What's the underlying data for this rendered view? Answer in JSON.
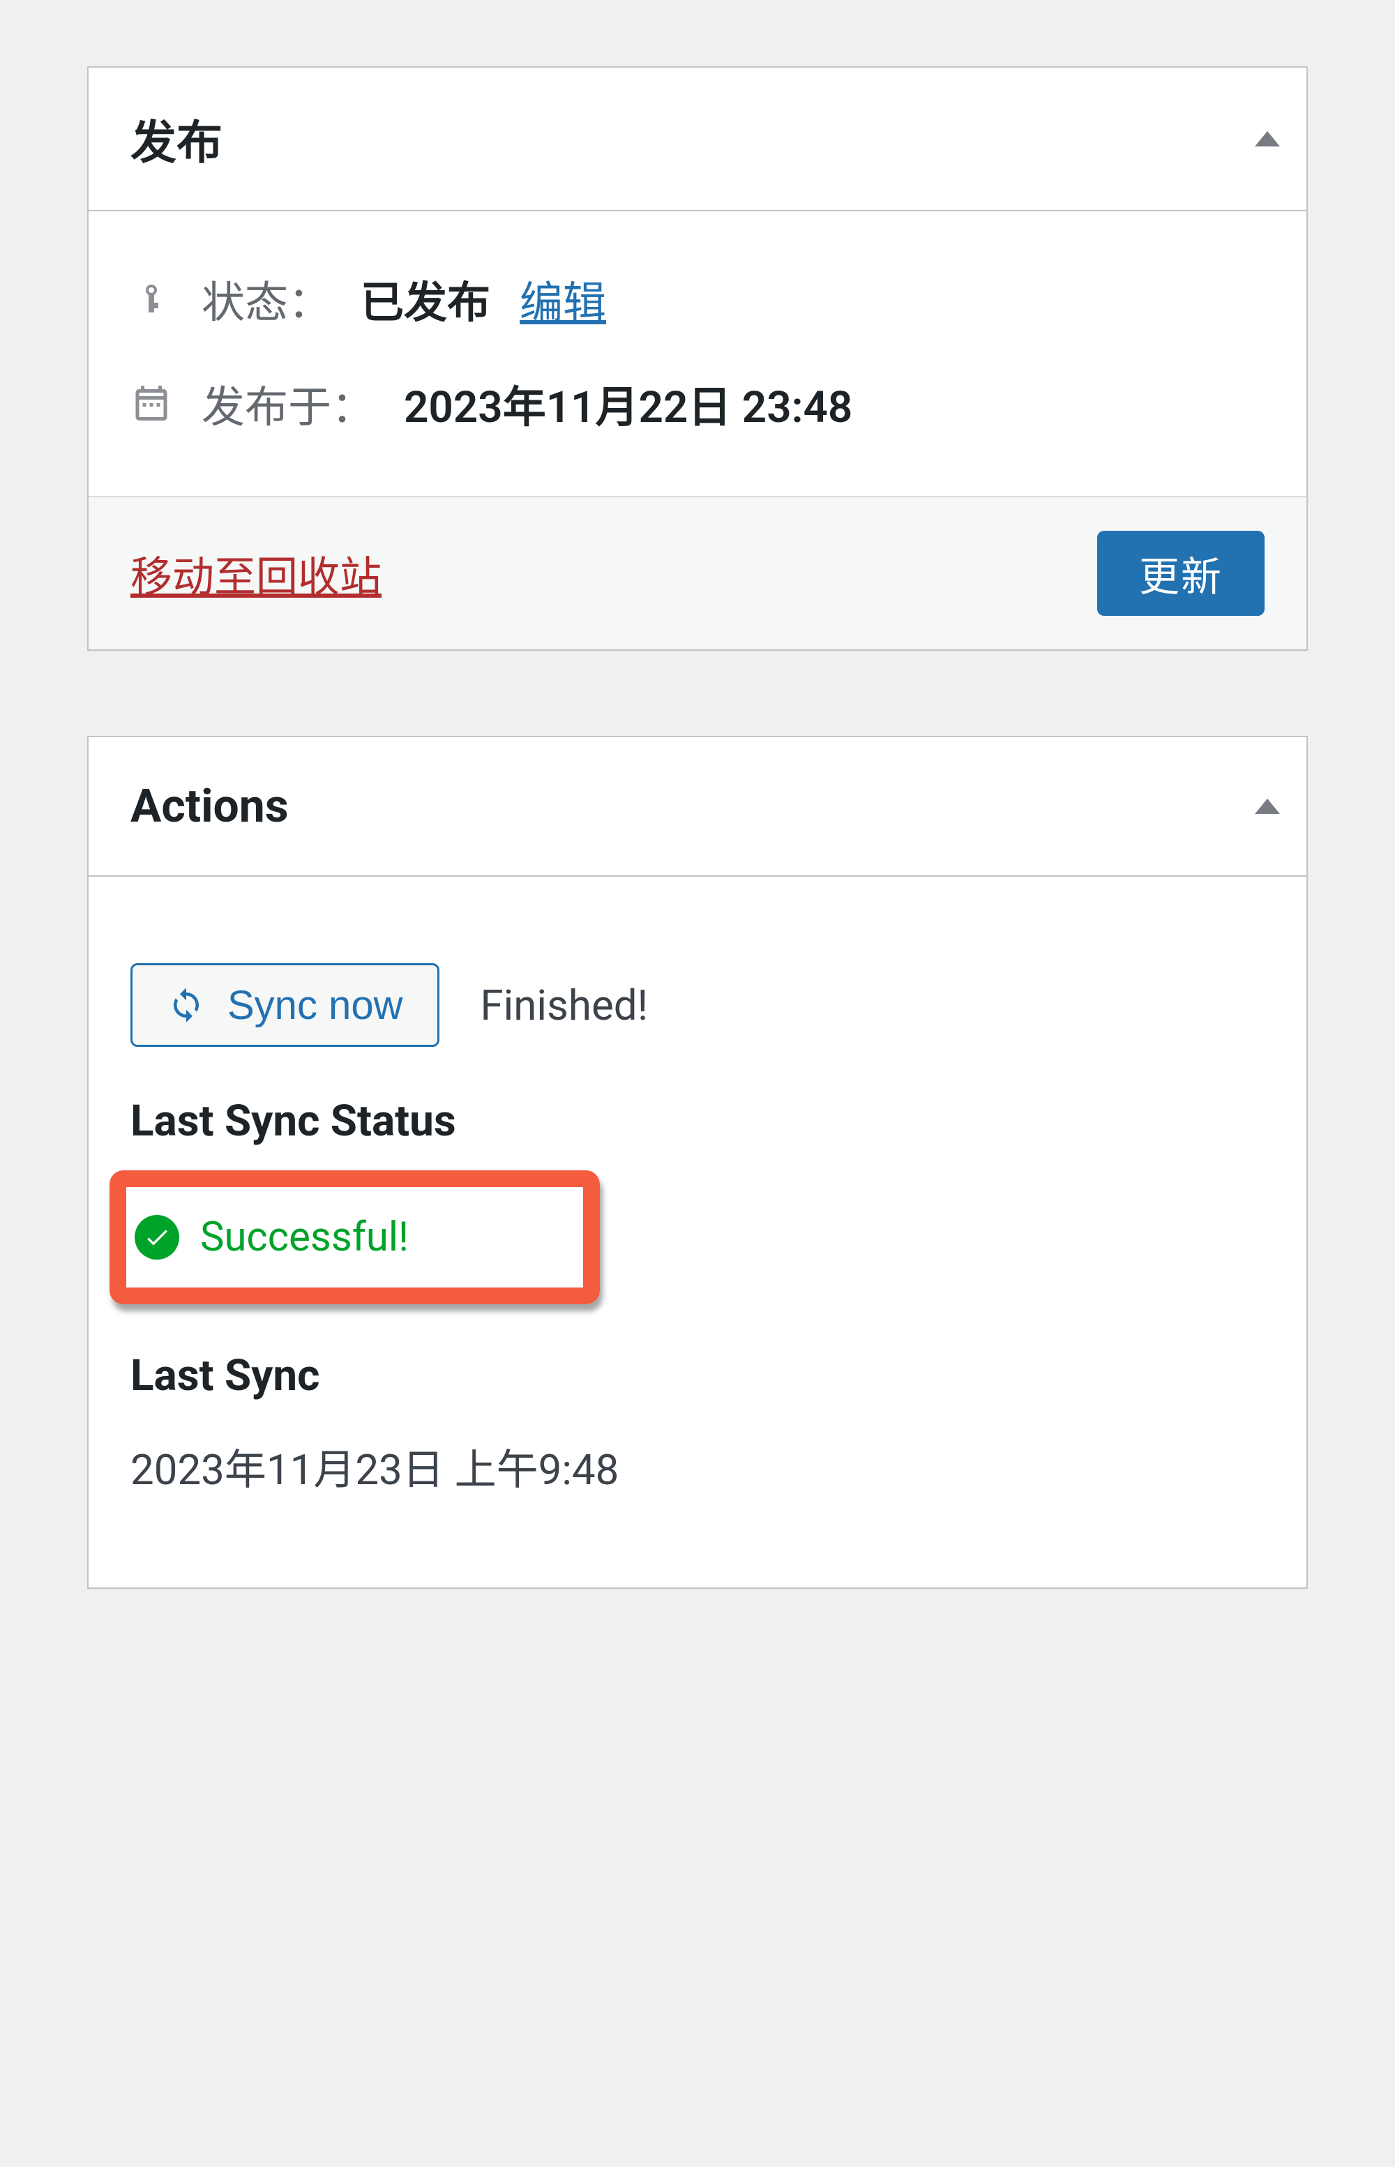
{
  "publish_box": {
    "title": "发布",
    "status_label": "状态：",
    "status_value": "已发布",
    "edit_link": "编辑",
    "published_on_label": "发布于：",
    "published_on_value": "2023年11月22日 23:48",
    "trash_label": "移动至回收站",
    "update_label": "更新"
  },
  "actions_box": {
    "title": "Actions",
    "sync_now_label": "Sync now",
    "finished_label": "Finished!",
    "last_sync_status_label": "Last Sync Status",
    "status_value": "Successful!",
    "last_sync_label": "Last Sync",
    "last_sync_value": "2023年11月23日 上午9:48"
  }
}
